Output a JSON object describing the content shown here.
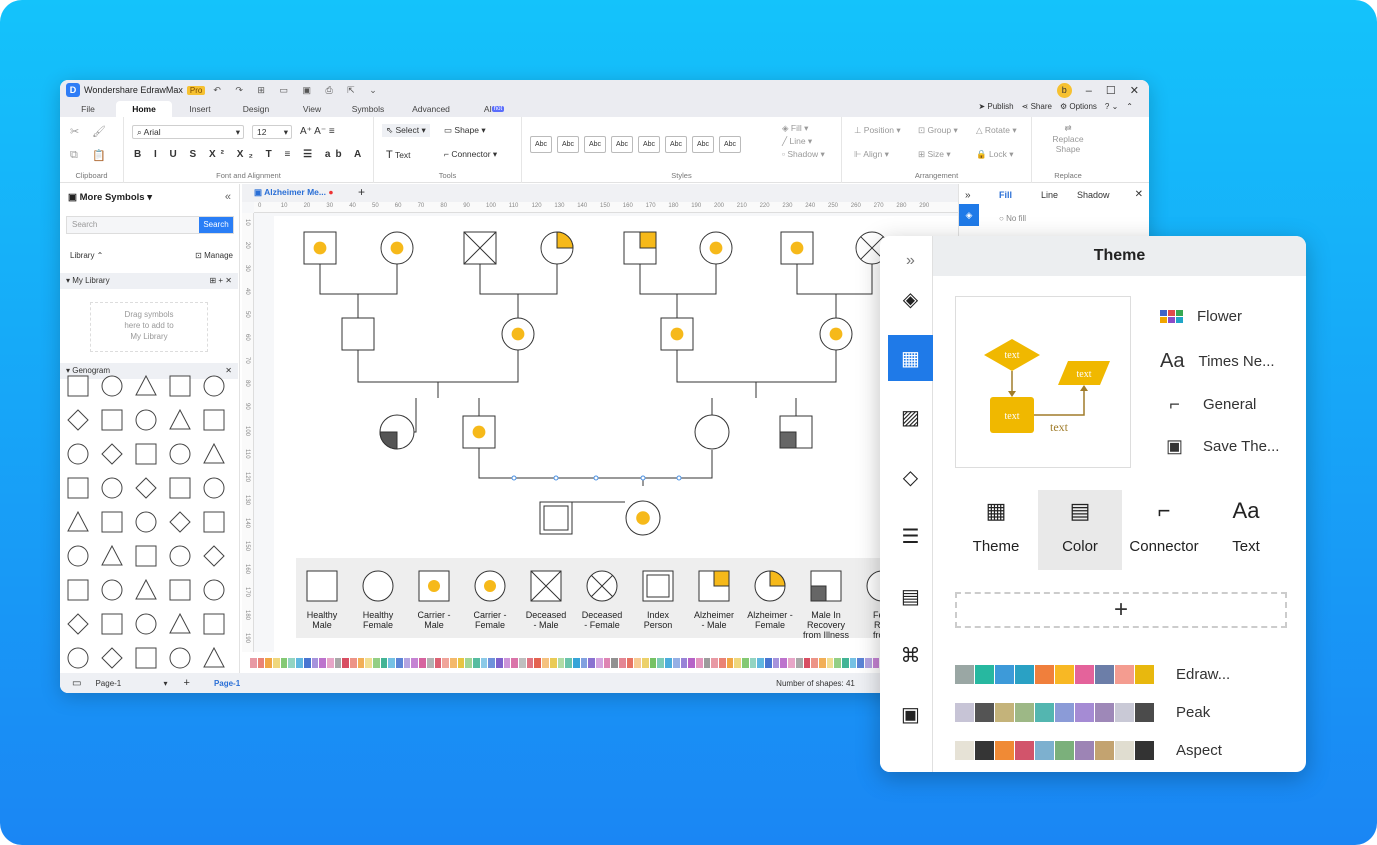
{
  "window": {
    "app_title": "Wondershare EdrawMax",
    "pro_badge": "Pro",
    "avatar_initial": "b",
    "menu_tabs": [
      "File",
      "Home",
      "Insert",
      "Design",
      "View",
      "Symbols",
      "Advanced",
      "AI"
    ],
    "active_tab": "Home",
    "ai_badge": "hot",
    "publish": "Publish",
    "share": "Share",
    "options": "Options"
  },
  "ribbon": {
    "clipboard_label": "Clipboard",
    "font_label": "Font and Alignment",
    "font_name": "Arial",
    "font_size": "12",
    "tools_label": "Tools",
    "select": "Select",
    "shape": "Shape",
    "text": "Text",
    "connector": "Connector",
    "styles_label": "Styles",
    "style_sample": "Abc",
    "fill": "Fill",
    "line": "Line",
    "shadow": "Shadow",
    "position": "Position",
    "group": "Group",
    "rotate": "Rotate",
    "align": "Align",
    "size": "Size",
    "lock": "Lock",
    "arrangement_label": "Arrangement",
    "replace_shape_1": "Replace",
    "replace_shape_2": "Shape",
    "replace_label": "Replace"
  },
  "left_panel": {
    "title": "More Symbols",
    "search_placeholder": "Search",
    "search_button": "Search",
    "library": "Library",
    "manage": "Manage",
    "my_library": "My Library",
    "drop_hint_1": "Drag symbols",
    "drop_hint_2": "here to add to",
    "drop_hint_3": "My Library",
    "genogram": "Genogram"
  },
  "canvas": {
    "doc_tab": "Alzheimer Me...",
    "ruler_h": [
      "0",
      "10",
      "20",
      "30",
      "40",
      "50",
      "60",
      "70",
      "80",
      "90",
      "100",
      "110",
      "120",
      "130",
      "140",
      "150",
      "160",
      "170",
      "180",
      "190",
      "200",
      "210",
      "220",
      "230",
      "240",
      "250",
      "260",
      "270",
      "280",
      "290"
    ],
    "ruler_v": [
      "10",
      "20",
      "30",
      "40",
      "50",
      "60",
      "70",
      "80",
      "90",
      "100",
      "110",
      "120",
      "130",
      "140",
      "150",
      "160",
      "170",
      "180",
      "190"
    ],
    "legend": [
      {
        "l1": "Healthy",
        "l2": "Male",
        "l3": ""
      },
      {
        "l1": "Healthy",
        "l2": "Female",
        "l3": ""
      },
      {
        "l1": "Carrier -",
        "l2": "Male",
        "l3": ""
      },
      {
        "l1": "Carrier -",
        "l2": "Female",
        "l3": ""
      },
      {
        "l1": "Deceased",
        "l2": "- Male",
        "l3": ""
      },
      {
        "l1": "Deceased",
        "l2": "- Female",
        "l3": ""
      },
      {
        "l1": "Index",
        "l2": "Person",
        "l3": ""
      },
      {
        "l1": "Alzheimer",
        "l2": "- Male",
        "l3": ""
      },
      {
        "l1": "Alzheimer -",
        "l2": "Female",
        "l3": ""
      },
      {
        "l1": "Male In",
        "l2": "Recovery",
        "l3": "from Illness"
      },
      {
        "l1": "Fem",
        "l2": "Rec",
        "l3": "from"
      }
    ]
  },
  "status": {
    "page_sel": "Page-1",
    "page_tab": "Page-1",
    "shapes": "Number of shapes: 41"
  },
  "right_strip": {
    "fill": "Fill",
    "line": "Line",
    "shadow": "Shadow",
    "no_fill": "No fill"
  },
  "theme_panel": {
    "title": "Theme",
    "preview_text": "text",
    "options": [
      "Flower",
      "Times Ne...",
      "General",
      "Save The..."
    ],
    "tabs": [
      "Theme",
      "Color",
      "Connector",
      "Text"
    ],
    "active_tab": "Color",
    "palettes": [
      {
        "name": "Edraw...",
        "colors": [
          "#9aa7a4",
          "#27b8a0",
          "#3d9ad9",
          "#2aa1c4",
          "#f07f3c",
          "#f8b824",
          "#e4639b",
          "#6c7ea8",
          "#f49c90",
          "#e8b80e"
        ]
      },
      {
        "name": "Peak",
        "colors": [
          "#c7c4d6",
          "#545454",
          "#c4b37a",
          "#9db886",
          "#53b6b0",
          "#8b9bd7",
          "#a58bd4",
          "#9e88b8",
          "#c9c9d6",
          "#4b4b4b"
        ]
      },
      {
        "name": "Aspect",
        "colors": [
          "#e6e2d6",
          "#353535",
          "#f08a35",
          "#d2546b",
          "#7db0cf",
          "#7bb07b",
          "#9d84b5",
          "#c3a370",
          "#e0ddd0",
          "#333333"
        ]
      }
    ]
  }
}
